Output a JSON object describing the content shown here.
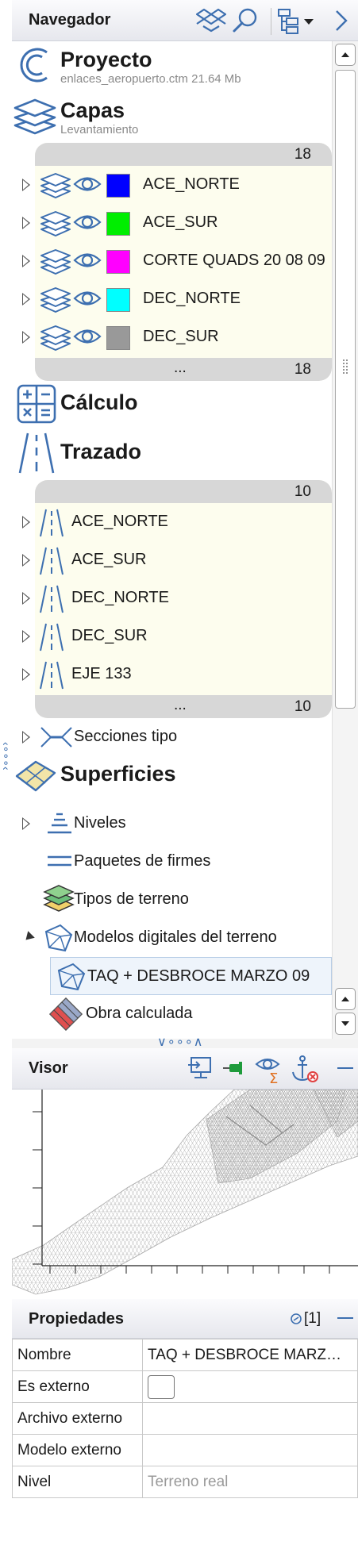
{
  "navigator": {
    "title": "Navegador",
    "project": {
      "title": "Proyecto",
      "subtitle": "enlaces_aeropuerto.ctm 21.64 Mb"
    },
    "layers": {
      "title": "Capas",
      "subtitle": "Levantamiento",
      "count_top": "18",
      "count_bottom": "18",
      "more": "...",
      "items": [
        {
          "label": "ACE_NORTE",
          "color": "#0000ff"
        },
        {
          "label": "ACE_SUR",
          "color": "#00ee00"
        },
        {
          "label": "CORTE QUADS 20 08 09",
          "color": "#ff00ff"
        },
        {
          "label": "DEC_NORTE",
          "color": "#00ffff"
        },
        {
          "label": "DEC_SUR",
          "color": "#999999"
        }
      ]
    },
    "calculo": {
      "title": "Cálculo"
    },
    "trazado": {
      "title": "Trazado",
      "count_top": "10",
      "count_bottom": "10",
      "more": "...",
      "items": [
        {
          "label": "ACE_NORTE"
        },
        {
          "label": "ACE_SUR"
        },
        {
          "label": "DEC_NORTE"
        },
        {
          "label": "DEC_SUR"
        },
        {
          "label": "EJE 133"
        }
      ]
    },
    "secciones_tipo": "Secciones tipo",
    "superficies": {
      "title": "Superficies",
      "niveles": "Niveles",
      "paquetes": "Paquetes de firmes",
      "tipos_terreno": "Tipos de terreno",
      "modelos": "Modelos digitales del terreno",
      "modelo_item": "TAQ + DESBROCE MARZO 09",
      "obra": "Obra calculada"
    }
  },
  "visor": {
    "title": "Visor"
  },
  "properties": {
    "title": "Propiedades",
    "count": "[1]",
    "rows": [
      {
        "key": "Nombre",
        "value": "TAQ + DESBROCE MARZO 09"
      },
      {
        "key": "Es externo",
        "value": ""
      },
      {
        "key": "Archivo externo",
        "value": ""
      },
      {
        "key": "Modelo externo",
        "value": ""
      },
      {
        "key": "Nivel",
        "value": "",
        "placeholder": "Terreno real"
      }
    ]
  },
  "colors": {
    "accent": "#3d6fb0",
    "header_bg": "#e6e7ed",
    "group_bg": "#fdfdee",
    "group_bar": "#d7d7d7",
    "selected_bg": "#eef4fb"
  }
}
